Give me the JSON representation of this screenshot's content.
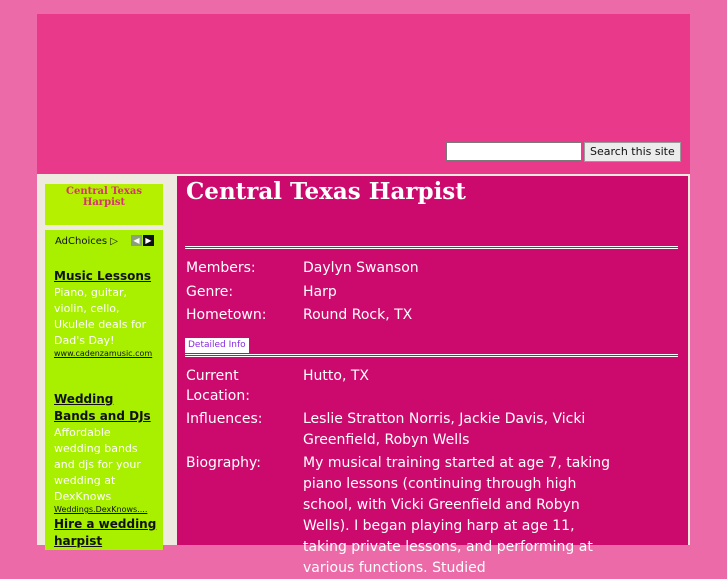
{
  "search": {
    "placeholder": "",
    "button_label": "Search this site"
  },
  "sidebar": {
    "title": "Central Texas Harpist"
  },
  "ads": {
    "adchoices_label": "AdChoices",
    "items": [
      {
        "title": "Music Lessons",
        "text": "Piano, guitar, violin, cello, Ukulele deals for Dad's Day!",
        "url": "www.cadenzamusic.com"
      },
      {
        "title": "Wedding Bands and DJs",
        "text": "Affordable wedding bands and djs for your wedding at DexKnows",
        "url": "Weddings.DexKnows...."
      },
      {
        "title": "Hire a wedding harpist",
        "text": "",
        "url": ""
      }
    ]
  },
  "main": {
    "title": "Central Texas Harpist",
    "fields": {
      "members_label": "Members:",
      "members_value": "Daylyn Swanson",
      "genre_label": "Genre:",
      "genre_value": "Harp",
      "hometown_label": "Hometown:",
      "hometown_value": "Round Rock, TX"
    },
    "tab_label": "Detailed Info",
    "details": {
      "location_label": "Current Location:",
      "location_value": "Hutto, TX",
      "influences_label": "Influences:",
      "influences_value": "Leslie Stratton Norris, Jackie Davis, Vicki Greenfield, Robyn Wells",
      "biography_label": "Biography:",
      "biography_value": "My musical training started at age 7, taking piano lessons (continuing through high school, with Vicki Greenfield and Robyn Wells). I began playing harp at age 11, taking private lessons, and performing at various functions. Studied"
    }
  },
  "colors": {
    "page_bg": "#ec6aa8",
    "header_bg": "#e8398a",
    "main_bg": "#cc0a6e",
    "sidebar_bg": "#a8f000",
    "title_accent": "#d6336f"
  }
}
